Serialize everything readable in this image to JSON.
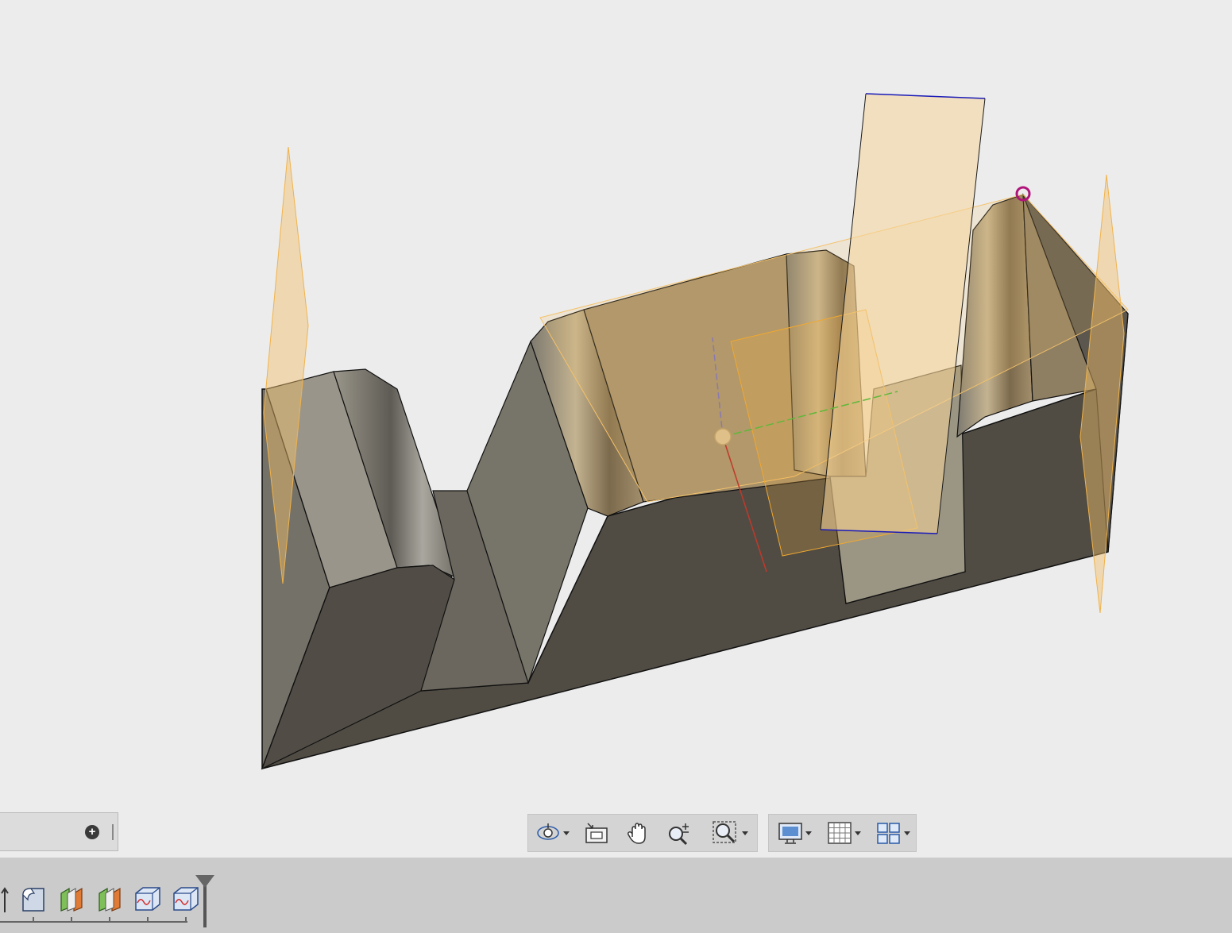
{
  "viewport": {
    "model_colors": {
      "background": "#ececec",
      "body_side": "#504c44",
      "body_top": "#8f8c82",
      "plane_fill": "#f5c26b",
      "sketch_line": "#1a1ab8",
      "selection_marker": "#b0147a"
    }
  },
  "browser_panel": {
    "add_icon": "plus-circle-icon"
  },
  "navigation_bar": {
    "tools": [
      {
        "icon": "orbit-icon",
        "has_dropdown": true
      },
      {
        "icon": "look-at-icon",
        "has_dropdown": false
      },
      {
        "icon": "pan-hand-icon",
        "has_dropdown": false
      },
      {
        "icon": "zoom-icon",
        "has_dropdown": false
      },
      {
        "icon": "fit-zoom-window-icon",
        "has_dropdown": true
      }
    ],
    "display_tools": [
      {
        "icon": "display-settings-icon",
        "has_dropdown": true
      },
      {
        "icon": "grid-snaps-icon",
        "has_dropdown": true
      },
      {
        "icon": "viewports-icon",
        "has_dropdown": true
      }
    ]
  },
  "timeline": {
    "items": [
      {
        "icon": "fillet-feature-icon"
      },
      {
        "icon": "offset-plane-icon"
      },
      {
        "icon": "offset-plane-icon"
      },
      {
        "icon": "sketch-icon"
      },
      {
        "icon": "sketch-icon"
      }
    ]
  }
}
